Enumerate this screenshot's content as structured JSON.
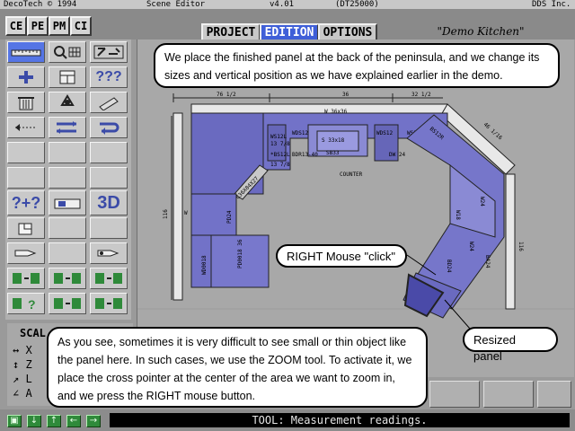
{
  "titlebar": {
    "app": "DecoTech © 1994",
    "editor": "Scene Editor",
    "version": "v4.01",
    "code": "(DT25000)",
    "company": "DDS Inc."
  },
  "top_buttons": [
    "CE",
    "PE",
    "PM",
    "CI"
  ],
  "mode_tabs": [
    {
      "label": "PROJECT",
      "active": false
    },
    {
      "label": "EDITION",
      "active": true
    },
    {
      "label": "OPTIONS",
      "active": false
    }
  ],
  "project_name": "\"Demo Kitchen\"",
  "palette": {
    "tools": [
      {
        "icon": "ruler-icon"
      },
      {
        "icon": "zoom-grid-icon"
      },
      {
        "icon": "expand-view-icon"
      },
      {
        "icon": "plus-icon"
      },
      {
        "icon": "cabinet-icon"
      },
      {
        "icon": "question-marks-icon"
      },
      {
        "icon": "trash-icon"
      },
      {
        "icon": "recycle-icon"
      },
      {
        "icon": "pencil-icon"
      },
      {
        "icon": "dotted-arrow-icon"
      },
      {
        "icon": "exchange-icon"
      },
      {
        "icon": "return-icon"
      },
      {
        "icon": "empty"
      },
      {
        "icon": "empty"
      },
      {
        "icon": "empty"
      },
      {
        "icon": "empty"
      },
      {
        "icon": "empty"
      },
      {
        "icon": "empty"
      },
      {
        "icon": "help-plus-icon"
      },
      {
        "icon": "floorplan-icon"
      },
      {
        "icon": "view-3d-icon",
        "label": "3D"
      },
      {
        "icon": "corner-icon"
      },
      {
        "icon": "empty"
      },
      {
        "icon": "empty"
      },
      {
        "icon": "hand-pointer-icon"
      },
      {
        "icon": "empty"
      },
      {
        "icon": "hand-pointer-right-icon"
      },
      {
        "icon": "grid-to-grid-icon"
      },
      {
        "icon": "grid-to-grid-icon"
      },
      {
        "icon": "grid-to-grid-icon"
      },
      {
        "icon": "grid-question-icon"
      },
      {
        "icon": "grid-to-grid-icon"
      },
      {
        "icon": "grid-to-grid-icon"
      }
    ]
  },
  "scale_panel": {
    "title": "SCAL",
    "rows": [
      {
        "arrow": "↔",
        "axis": "X"
      },
      {
        "arrow": "↕",
        "axis": "Z"
      },
      {
        "arrow": "↗",
        "axis": "L"
      },
      {
        "arrow": "∠",
        "axis": "A"
      }
    ]
  },
  "plan": {
    "dims_top": [
      "76 1/2",
      "36",
      "32 1/2"
    ],
    "dim_diag": "46 1/16",
    "dim_left": "116",
    "dim_right": "116",
    "wall_labels": [
      "W",
      "W"
    ],
    "cabinet_labels": [
      "W 36x36",
      "WS12L",
      "WDS12",
      "WDS12",
      "WS12R",
      "13 7/8",
      "S 33x18",
      "SB33",
      "*BS12L",
      "BDR13-40",
      "13 7/8",
      "DW 24",
      "COUNTER",
      "C36X84X27",
      "PD24",
      "WD0018",
      "PD0018 36",
      "W24",
      "W18",
      "W24",
      "BD24",
      "BS12R",
      "BA24"
    ],
    "counter": "COUNTER"
  },
  "bubbles": {
    "top": "We place the finished panel at the back of the peninsula, and we change its sizes and vertical position as we have explained earlier in the demo.",
    "click": "RIGHT Mouse \"click\"",
    "resized": "Resized panel",
    "bottom": "As you see, sometimes it is very difficult to see small or thin object like the panel here. In such cases, we use the ZOOM tool. To activate it, we place the cross pointer at the center of the area we want to zoom in, and we press the RIGHT mouse button."
  },
  "status": {
    "nav": [
      "▣",
      "↓",
      "↑",
      "←",
      "→"
    ],
    "text": "TOOL: Measurement readings."
  },
  "colors": {
    "cabinet": "#7272c8",
    "cabinet_light": "#9494d8",
    "active_tab": "#3f5fd8",
    "status_bg": "#000000",
    "nav_green": "#2f8a3a"
  }
}
